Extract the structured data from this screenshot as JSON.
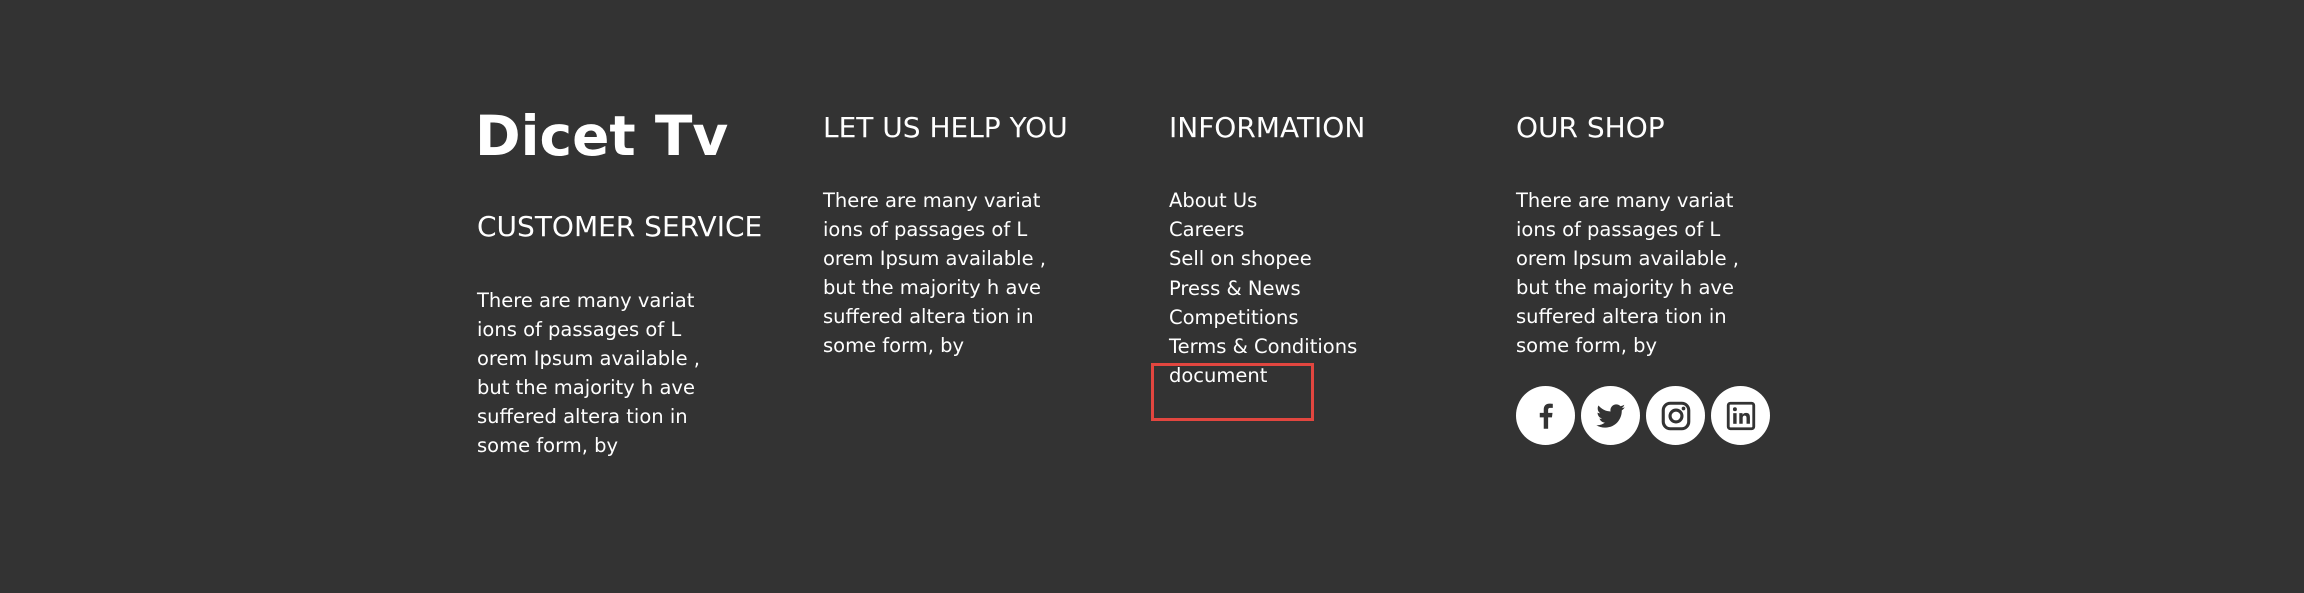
{
  "brand": "Dicet Tv",
  "customer_service": {
    "heading": "CUSTOMER SERVICE",
    "text": "There are many variat\nions of passages of L\norem Ipsum available ,\nbut the majority h ave\nsuffered altera tion in\nsome form, by"
  },
  "help": {
    "heading": "LET US HELP YOU",
    "text": "There are many variat\nions of passages of L\norem Ipsum available ,\nbut the majority h ave\nsuffered altera tion in\nsome form, by"
  },
  "information": {
    "heading": "INFORMATION",
    "links": [
      "About Us",
      "Careers",
      "Sell on shopee",
      "Press & News",
      "Competitions",
      "Terms & Conditions",
      "document"
    ]
  },
  "shop": {
    "heading": "OUR SHOP",
    "text": "There are many variat\nions of passages of L\norem Ipsum available ,\nbut the majority h ave\nsuffered altera tion in\nsome form, by"
  },
  "social": {
    "icons": [
      "facebook-icon",
      "twitter-icon",
      "instagram-icon",
      "linkedin-icon"
    ]
  },
  "colors": {
    "background": "#333333",
    "text": "#ffffff",
    "highlight": "#e2463f"
  }
}
